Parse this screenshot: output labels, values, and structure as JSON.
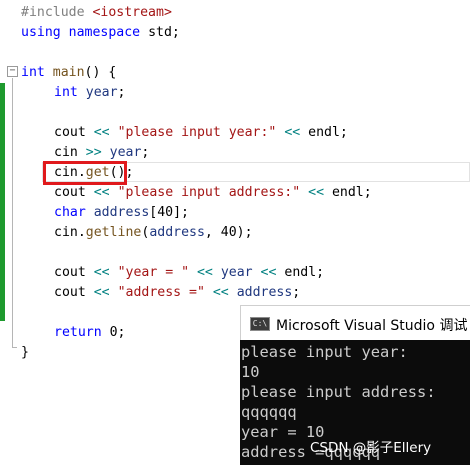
{
  "editor": {
    "lines": {
      "include": {
        "directive": "#include",
        "header": "<iostream>"
      },
      "using": {
        "kw1": "using",
        "kw2": "namespace",
        "rest": " std;"
      },
      "main": {
        "type": "int",
        "name": "main",
        "rest": "() {"
      },
      "decl_year": {
        "type": "int",
        "name": "year",
        "rest": ";"
      },
      "cout1": {
        "stream": "cout",
        "op1": "<<",
        "str": "\"please input year:\"",
        "op2": "<<",
        "endl": "endl",
        "semi": ";"
      },
      "cin_year": {
        "stream": "cin",
        "op": ">>",
        "var": "year",
        "semi": ";"
      },
      "cin_get": {
        "stream": "cin",
        "dot": ".",
        "method": "get",
        "rest": "();"
      },
      "cout2": {
        "stream": "cout",
        "op1": "<<",
        "str": "\"please input address:\"",
        "op2": "<<",
        "endl": "endl",
        "semi": ";"
      },
      "decl_address": {
        "type": "char",
        "name": "address",
        "rest": "[40];"
      },
      "getline": {
        "stream": "cin",
        "dot": ".",
        "method": "getline",
        "open": "(",
        "arg": "address",
        "rest": ", 40);"
      },
      "cout3": {
        "stream": "cout",
        "op1": "<<",
        "str": "\"year = \"",
        "op2": "<<",
        "var": "year",
        "op3": "<<",
        "endl": "endl",
        "semi": ";"
      },
      "cout4": {
        "stream": "cout",
        "op1": "<<",
        "str": "\"address =\"",
        "op2": "<<",
        "var": "address",
        "semi": ";"
      },
      "ret": {
        "kw": "return",
        "rest": " 0;"
      },
      "close": {
        "text": "}"
      }
    },
    "fold_symbol": "−"
  },
  "console": {
    "icon": "C:\\",
    "title": "Microsoft Visual Studio 调试",
    "output": [
      "please input year:",
      "10",
      "please input address:",
      "qqqqqq",
      "year = 10",
      "address =qqqqqq"
    ]
  },
  "watermark": "CSDN @影子Ellery",
  "colors": {
    "keyword": "#0000ff",
    "string": "#a31515",
    "function": "#74531f",
    "variable": "#1f377f",
    "operator": "#008080",
    "preprocessor": "#808080",
    "highlight_border": "#e0191c",
    "gutter_bar": "#1e9a2e",
    "console_bg": "#0c0c0c"
  }
}
